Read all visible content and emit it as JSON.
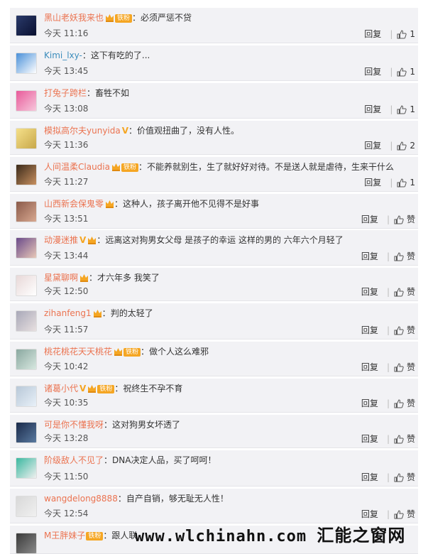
{
  "comments": [
    {
      "user": "黑山老妖我来也",
      "v": false,
      "crown": true,
      "fan": "铁粉",
      "text": "必须严惩不贷",
      "time": "今天 11:16",
      "reply": "回复",
      "likes": "1",
      "av": [
        "#2a3a6a",
        "#0a1030"
      ]
    },
    {
      "user": "Kimi_lxy-",
      "v": false,
      "crown": false,
      "fan": "",
      "text": "这下有吃的了...",
      "time": "今天 13:45",
      "reply": "回复",
      "likes": "1",
      "av": [
        "#4a90d9",
        "#ffffff"
      ],
      "blue": true
    },
    {
      "user": "打兔子跨栏",
      "v": false,
      "crown": false,
      "fan": "",
      "text": "畜牲不如",
      "time": "今天 13:08",
      "reply": "回复",
      "likes": "1",
      "av": [
        "#e85a9a",
        "#f7c8dc"
      ]
    },
    {
      "user": "模拟高尔夫yunyida",
      "v": true,
      "crown": false,
      "fan": "",
      "text": "价值观扭曲了，没有人性。",
      "time": "今天 11:36",
      "reply": "回复",
      "likes": "2",
      "av": [
        "#f5e08a",
        "#c8a84a"
      ]
    },
    {
      "user": "人间温柔Claudia",
      "v": false,
      "crown": true,
      "fan": "铁粉",
      "text": "不能养就别生，生了就好好对待。不是送人就是虐待，生来干什么",
      "time": "今天 11:27",
      "reply": "回复",
      "likes": "1",
      "av": [
        "#3a2a1a",
        "#c89060"
      ]
    },
    {
      "user": "山西新会保鬼零",
      "v": false,
      "crown": true,
      "fan": "",
      "text": "这种人，孩子离开他不见得不是好事",
      "time": "今天 13:51",
      "reply": "回复",
      "likes": "赞",
      "av": [
        "#8a5a4a",
        "#d8a890"
      ]
    },
    {
      "user": "动漫迷推",
      "v": true,
      "crown": true,
      "fan": "",
      "text": "远离这对狗男女父母 是孩子的幸运 这样的男的 六年六个月轻了",
      "time": "今天 13:44",
      "reply": "回复",
      "likes": "赞",
      "av": [
        "#6a4a8a",
        "#e8c8b8"
      ]
    },
    {
      "user": "星黛聊啊",
      "v": false,
      "crown": true,
      "fan": "",
      "text": "才六年多 我笑了",
      "time": "今天 12:50",
      "reply": "回复",
      "likes": "赞",
      "av": [
        "#e8d8d8",
        "#ffffff"
      ]
    },
    {
      "user": "zihanfeng1",
      "v": false,
      "crown": true,
      "fan": "",
      "text": "判的太轻了",
      "time": "今天 11:57",
      "reply": "回复",
      "likes": "赞",
      "av": [
        "#a8a8b8",
        "#e8e0e0"
      ]
    },
    {
      "user": "桃花桃花天天桃花",
      "v": false,
      "crown": true,
      "fan": "铁粉",
      "text": "做个人这么难邪",
      "time": "今天 10:42",
      "reply": "回复",
      "likes": "赞",
      "av": [
        "#8aa8a0",
        "#d8e8e0"
      ]
    },
    {
      "user": "诸葛小代",
      "v": true,
      "crown": true,
      "fan": "铁粉",
      "text": "祝终生不孕不育",
      "time": "今天 10:35",
      "reply": "回复",
      "likes": "赞",
      "av": [
        "#b8c8d8",
        "#e8f0f8"
      ]
    },
    {
      "user": "可是你不懂我呀",
      "v": false,
      "crown": false,
      "fan": "",
      "text": "这对狗男女坏透了",
      "time": "今天 13:28",
      "reply": "回复",
      "likes": "赞",
      "av": [
        "#1a2a4a",
        "#5a7aa0"
      ]
    },
    {
      "user": "阶级敌人不见了",
      "v": false,
      "crown": false,
      "fan": "",
      "text": "DNA决定人品，买了呵呵！",
      "time": "今天 11:50",
      "reply": "回复",
      "likes": "赞",
      "av": [
        "#3ab8a0",
        "#f0f0f0"
      ]
    },
    {
      "user": "wangdelong8888",
      "v": false,
      "crown": false,
      "fan": "",
      "text": "自产自销，够无耻无人性！",
      "time": "今天 12:54",
      "reply": "回复",
      "likes": "赞",
      "av": [
        "#d8d8d8",
        "#f0f0f0"
      ]
    },
    {
      "user": "M王胖妹子",
      "v": false,
      "crown": false,
      "fan": "铁粉",
      "text": "跟人联",
      "time": "",
      "reply": "",
      "likes": "",
      "av": [
        "#3a3a3a",
        "#8a8a8a"
      ]
    }
  ],
  "watermark": {
    "url": "www.wlchinahn.com",
    "cn": "汇能之窗网"
  }
}
